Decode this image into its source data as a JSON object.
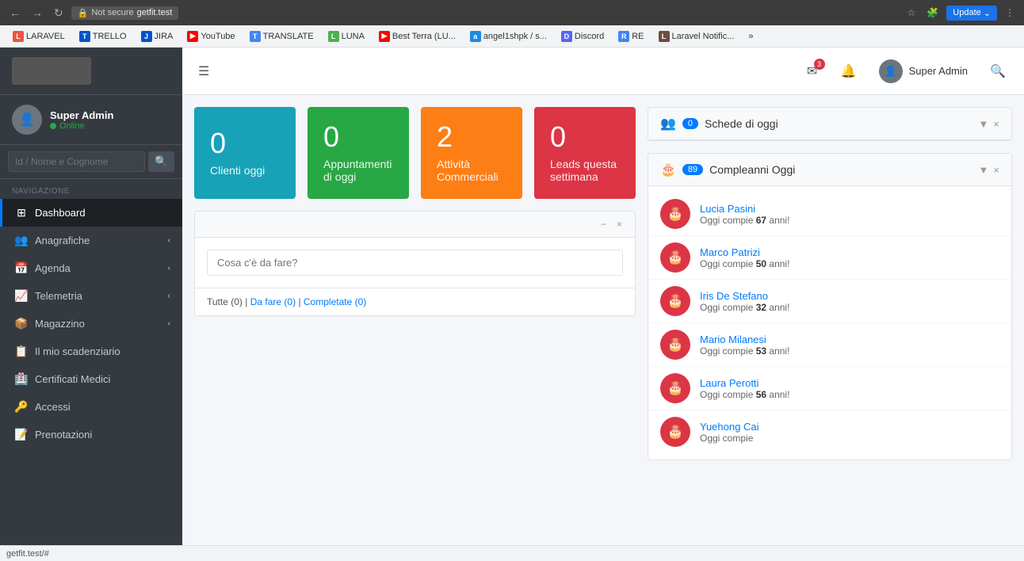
{
  "browser": {
    "nav_back": "←",
    "nav_forward": "→",
    "nav_refresh": "↻",
    "secure_label": "Not secure",
    "url": "getfit.test",
    "update_label": "Update",
    "bookmarks": [
      {
        "id": "laravel",
        "label": "LARAVEL",
        "fav_class": "fav-laravel",
        "fav_letter": "L"
      },
      {
        "id": "trello",
        "label": "TRELLO",
        "fav_class": "fav-trello",
        "fav_letter": "T"
      },
      {
        "id": "jira",
        "label": "JIRA",
        "fav_class": "fav-jira",
        "fav_letter": "J"
      },
      {
        "id": "youtube",
        "label": "YouTube",
        "fav_class": "fav-youtube",
        "fav_letter": "▶"
      },
      {
        "id": "translate",
        "label": "TRANSLATE",
        "fav_class": "fav-translate",
        "fav_letter": "T"
      },
      {
        "id": "luna",
        "label": "LUNA",
        "fav_class": "fav-luna",
        "fav_letter": "L"
      },
      {
        "id": "bestterra",
        "label": "Best Terra (LU...",
        "fav_class": "fav-bestterra",
        "fav_letter": "▶"
      },
      {
        "id": "angel",
        "label": "angel1shpk / s...",
        "fav_class": "fav-angel",
        "fav_letter": "a"
      },
      {
        "id": "discord",
        "label": "Discord",
        "fav_class": "fav-discord",
        "fav_letter": "D"
      },
      {
        "id": "re",
        "label": "RE",
        "fav_class": "fav-re",
        "fav_letter": "R"
      },
      {
        "id": "laravel2",
        "label": "Laravel Notific...",
        "fav_class": "fav-laravel2",
        "fav_letter": "L"
      }
    ]
  },
  "sidebar": {
    "user": {
      "name": "Super Admin",
      "status": "Online"
    },
    "search_placeholder": "Id / Nome e Cognome",
    "nav_label": "Navigazione",
    "items": [
      {
        "id": "dashboard",
        "label": "Dashboard",
        "icon": "⊞",
        "active": true,
        "has_arrow": false
      },
      {
        "id": "anagrafiche",
        "label": "Anagrafiche",
        "icon": "👥",
        "active": false,
        "has_arrow": true
      },
      {
        "id": "agenda",
        "label": "Agenda",
        "icon": "📅",
        "active": false,
        "has_arrow": true
      },
      {
        "id": "telemetria",
        "label": "Telemetria",
        "icon": "📈",
        "active": false,
        "has_arrow": true
      },
      {
        "id": "magazzino",
        "label": "Magazzino",
        "icon": "📦",
        "active": false,
        "has_arrow": true
      },
      {
        "id": "scadenziario",
        "label": "Il mio scadenziario",
        "icon": "📋",
        "active": false,
        "has_arrow": false
      },
      {
        "id": "certificati",
        "label": "Certificati Medici",
        "icon": "🏥",
        "active": false,
        "has_arrow": false
      },
      {
        "id": "accessi",
        "label": "Accessi",
        "icon": "🔑",
        "active": false,
        "has_arrow": false
      },
      {
        "id": "prenotazioni",
        "label": "Prenotazioni",
        "icon": "📝",
        "active": false,
        "has_arrow": false
      }
    ]
  },
  "header": {
    "menu_icon": "☰",
    "user_name": "Super Admin",
    "search_icon": "🔍",
    "bell_icon": "🔔",
    "mail_icon": "✉",
    "mail_badge": "3"
  },
  "stats": [
    {
      "value": "0",
      "label": "Clienti oggi",
      "color_class": "card-blue"
    },
    {
      "value": "0",
      "label": "Appuntamenti di oggi",
      "color_class": "card-green"
    },
    {
      "value": "2",
      "label": "Attività Commerciali",
      "color_class": "card-orange"
    },
    {
      "value": "0",
      "label": "Leads questa settimana",
      "color_class": "card-red"
    }
  ],
  "todo": {
    "minimize_btn": "−",
    "close_btn": "×",
    "input_placeholder": "Cosa c'è da fare?",
    "footer_tutte": "Tutte",
    "footer_tutte_count": "(0)",
    "footer_da_fare": "Da fare",
    "footer_da_fare_count": "(0)",
    "footer_completate": "Completate",
    "footer_completate_count": "(0)"
  },
  "schede_panel": {
    "icon": "👥",
    "count": "0",
    "title": "Schede di oggi",
    "minimize_btn": "▼",
    "close_btn": "×"
  },
  "compleanni_panel": {
    "icon": "🎂",
    "count": "89",
    "title": "Compleanni Oggi",
    "minimize_btn": "▼",
    "close_btn": "×",
    "birthdays": [
      {
        "name": "Lucia Pasini",
        "desc_prefix": "Oggi compie ",
        "age": "67",
        "desc_suffix": " anni!"
      },
      {
        "name": "Marco Patrizi",
        "desc_prefix": "Oggi compie ",
        "age": "50",
        "desc_suffix": " anni!"
      },
      {
        "name": "Iris De Stefano",
        "desc_prefix": "Oggi compie ",
        "age": "32",
        "desc_suffix": " anni!"
      },
      {
        "name": "Mario Milanesi",
        "desc_prefix": "Oggi compie ",
        "age": "53",
        "desc_suffix": " anni!"
      },
      {
        "name": "Laura Perotti",
        "desc_prefix": "Oggi compie ",
        "age": "56",
        "desc_suffix": " anni!"
      },
      {
        "name": "Yuehong Cai",
        "desc_prefix": "Oggi compie ",
        "age": "",
        "desc_suffix": ""
      }
    ]
  },
  "footer_url": "getfit.test/#"
}
